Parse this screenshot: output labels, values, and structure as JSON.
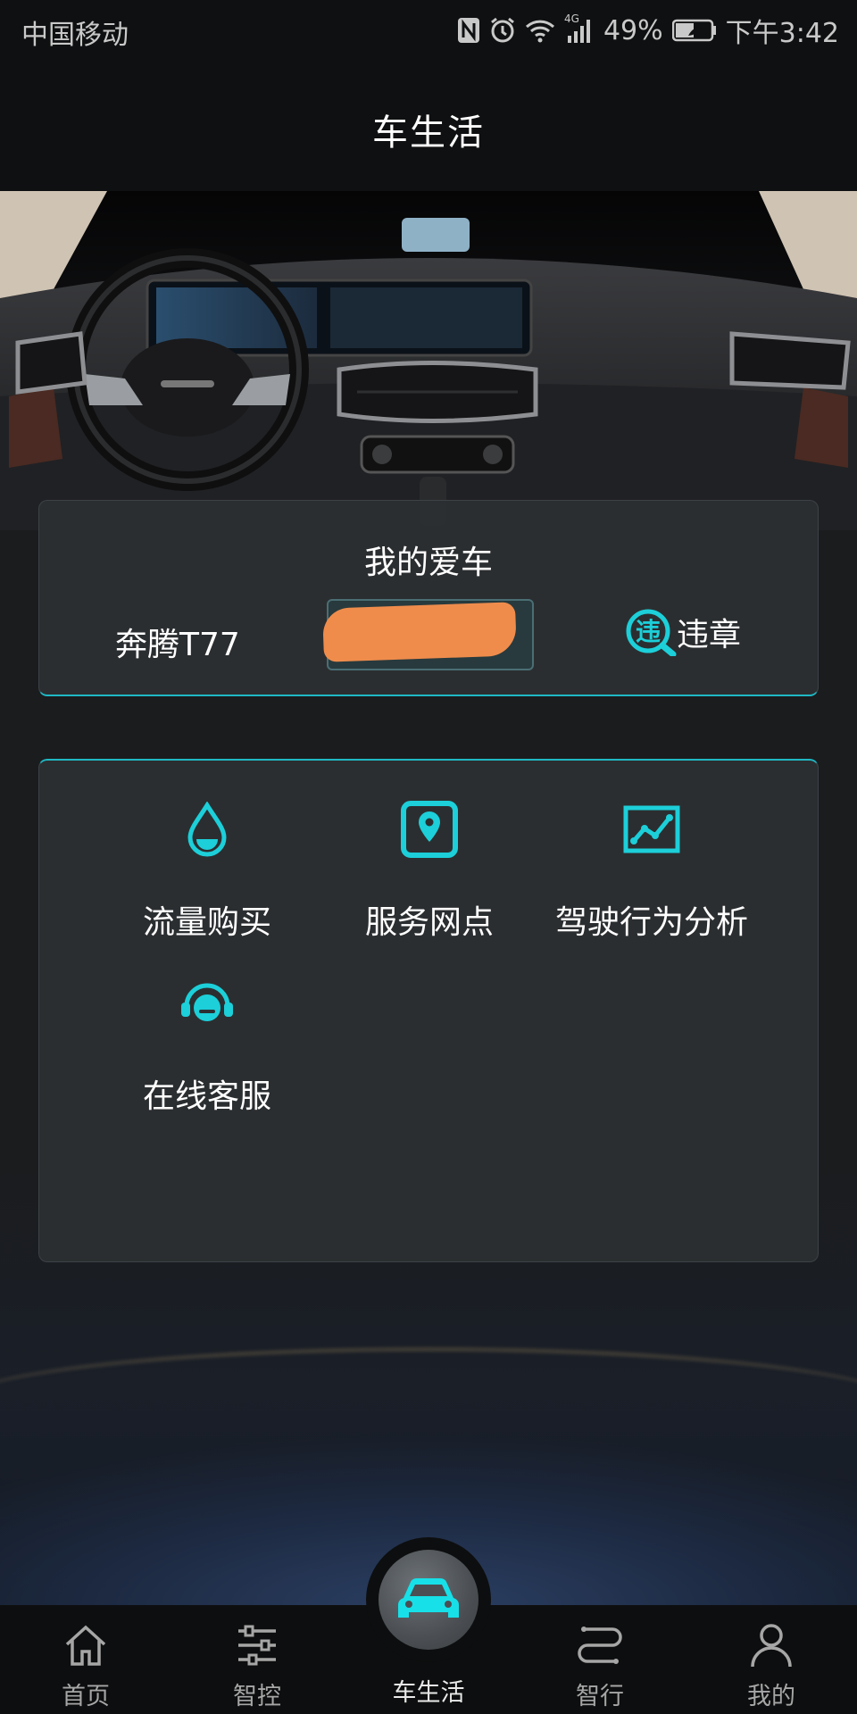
{
  "status_bar": {
    "carrier": "中国移动",
    "battery": "49%",
    "time": "下午3:42",
    "network": "4G"
  },
  "nav": {
    "title": "车生活"
  },
  "my_car": {
    "title": "我的爱车",
    "model": "奔腾T77",
    "violation_label": "违章",
    "violation_icon_char": "违"
  },
  "services": [
    {
      "label": "流量购买",
      "icon": "water-drop-icon"
    },
    {
      "label": "服务网点",
      "icon": "map-pin-icon"
    },
    {
      "label": "驾驶行为分析",
      "icon": "chart-icon"
    },
    {
      "label": "在线客服",
      "icon": "headset-icon"
    }
  ],
  "tabs": [
    {
      "label": "首页",
      "icon": "home-icon"
    },
    {
      "label": "智控",
      "icon": "sliders-icon"
    },
    {
      "label": "车生活",
      "icon": "car-icon"
    },
    {
      "label": "智行",
      "icon": "route-icon"
    },
    {
      "label": "我的",
      "icon": "user-icon"
    }
  ],
  "colors": {
    "accent": "#1ccfd9",
    "card": "#2c2f32",
    "background": "#1b1c1e",
    "plate_mask": "#ef8c4c"
  }
}
